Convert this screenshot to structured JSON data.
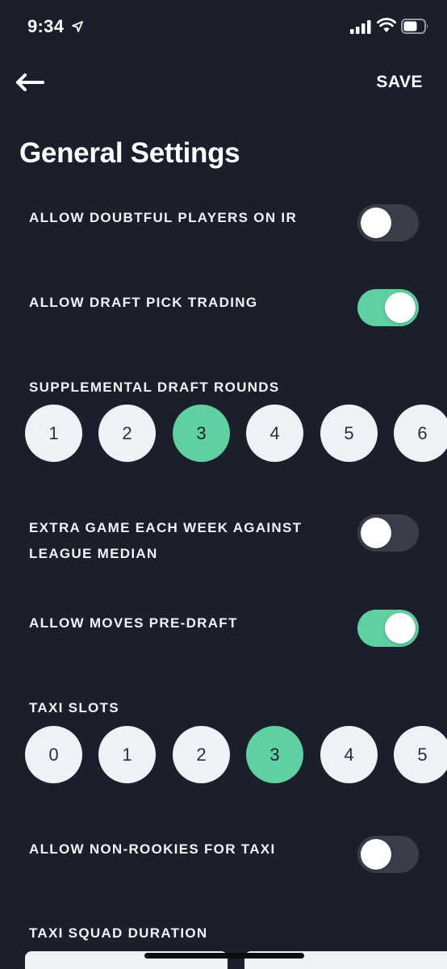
{
  "status_bar": {
    "time": "9:34"
  },
  "nav": {
    "save_label": "SAVE"
  },
  "page_title": "General Settings",
  "settings": {
    "doubtful_ir": {
      "label": "ALLOW DOUBTFUL PLAYERS ON IR",
      "enabled": false
    },
    "draft_pick_trading": {
      "label": "ALLOW DRAFT PICK TRADING",
      "enabled": true
    },
    "supplemental_rounds": {
      "label": "SUPPLEMENTAL DRAFT ROUNDS",
      "options": [
        "1",
        "2",
        "3",
        "4",
        "5",
        "6"
      ],
      "selected": "3"
    },
    "league_median": {
      "label": "EXTRA GAME EACH WEEK AGAINST LEAGUE MEDIAN",
      "enabled": false
    },
    "moves_pre_draft": {
      "label": "ALLOW MOVES PRE-DRAFT",
      "enabled": true
    },
    "taxi_slots": {
      "label": "TAXI SLOTS",
      "options": [
        "0",
        "1",
        "2",
        "3",
        "4",
        "5"
      ],
      "selected": "3"
    },
    "non_rookies_taxi": {
      "label": "ALLOW NON-ROOKIES FOR TAXI",
      "enabled": false
    },
    "taxi_duration": {
      "label": "TAXI SQUAD DURATION"
    }
  },
  "colors": {
    "background": "#1b1f2b",
    "accent": "#5fd0a0",
    "toggle_off": "#3a3e4b",
    "option_bg": "#eef1f5"
  },
  "icons": [
    "location-arrow-icon",
    "cell-signal-icon",
    "wifi-icon",
    "battery-icon",
    "back-arrow-icon"
  ]
}
